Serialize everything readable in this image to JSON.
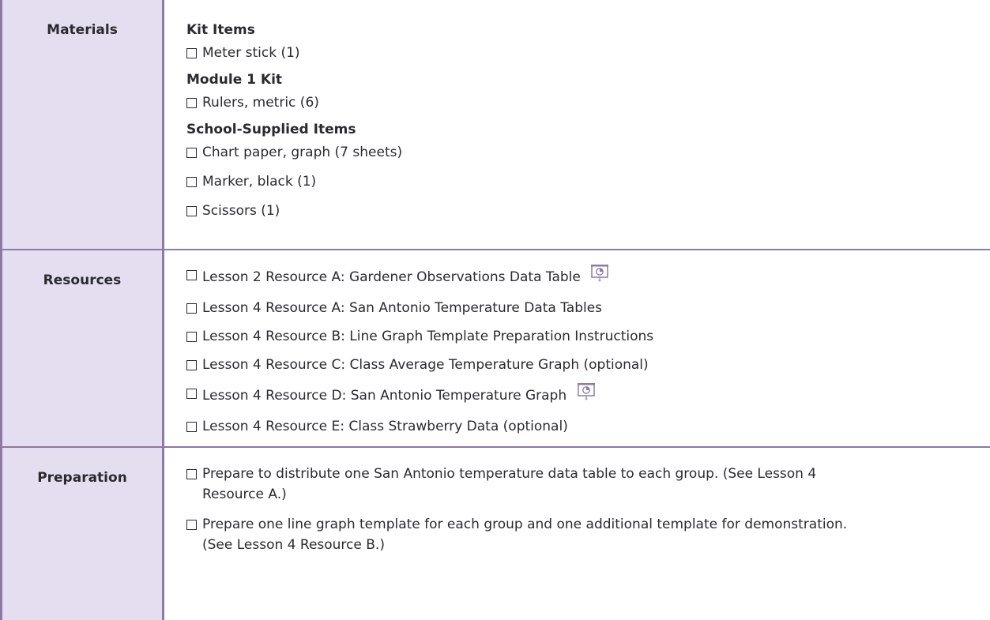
{
  "rows": {
    "materials": {
      "label": "Materials",
      "groups": [
        {
          "title": "Kit Items",
          "items": [
            "Meter stick (1)"
          ]
        },
        {
          "title": "Module 1 Kit",
          "items": [
            "Rulers, metric (6)"
          ]
        },
        {
          "title": "School-Supplied Items",
          "items": [
            "Chart paper, graph (7 sheets)",
            "Marker, black (1)",
            "Scissors (1)"
          ]
        }
      ]
    },
    "resources": {
      "label": "Resources",
      "items": [
        {
          "text": "Lesson 2 Resource A: Gardener Observations Data Table",
          "icon": "projector-icon"
        },
        {
          "text": "Lesson 4 Resource A: San Antonio Temperature Data Tables"
        },
        {
          "text": "Lesson 4 Resource B: Line Graph Template Preparation Instructions"
        },
        {
          "text": "Lesson 4 Resource C: Class Average Temperature Graph (optional)"
        },
        {
          "text": "Lesson 4 Resource D: San Antonio Temperature Graph",
          "icon": "projector-icon"
        },
        {
          "text": "Lesson 4 Resource E: Class Strawberry Data (optional)"
        }
      ]
    },
    "preparation": {
      "label": "Preparation",
      "items": [
        "Prepare to distribute one San Antonio temperature data table to each group. (See Lesson 4 Resource A.)",
        "Prepare one line graph template for each group and one additional template for demonstration. (See Lesson 4 Resource B.)"
      ]
    }
  },
  "colors": {
    "label_bg": "#e5def0",
    "border": "#8b7aa5",
    "text": "#2b2a30"
  }
}
